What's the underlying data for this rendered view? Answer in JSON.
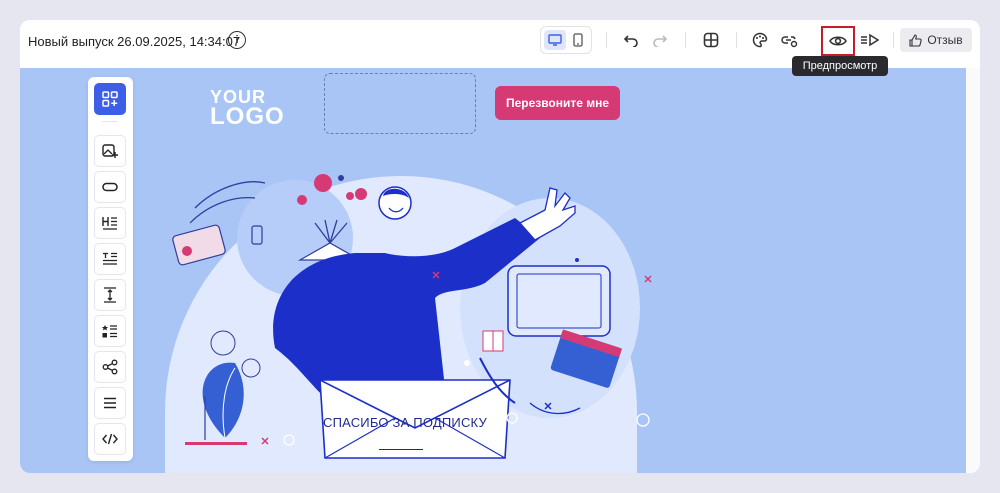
{
  "header": {
    "title": "Новый выпуск 26.09.2025, 14:34:07",
    "info_icon": "info-icon",
    "devices": [
      {
        "name": "desktop-view",
        "icon": "monitor-icon",
        "active": true
      },
      {
        "name": "mobile-view",
        "icon": "phone-icon",
        "active": false
      }
    ],
    "tools": [
      "undo-icon",
      "redo-icon",
      "grid-icon",
      "palette-icon",
      "link-settings-icon",
      "eye-icon",
      "send-test-icon"
    ],
    "review_label": "Отзыв",
    "tooltip": "Предпросмотр"
  },
  "editor": {
    "logo_line1": "YOUR",
    "logo_line2": "LOGO",
    "cta_label": "Перезвоните мне",
    "headline": "СПАСИБО ЗА ПОДПИСКУ",
    "palette": [
      "blocks-icon",
      "image-add-icon",
      "button-icon",
      "heading-icon",
      "text-icon",
      "spacer-icon",
      "list-icon",
      "social-share-icon",
      "menu-icon",
      "code-icon"
    ]
  },
  "colors": {
    "canvas_bg": "#a9c5f6",
    "accent_blue": "#3d5ee6",
    "cta_pink": "#d63a75",
    "highlight_red": "#c21f2b"
  }
}
